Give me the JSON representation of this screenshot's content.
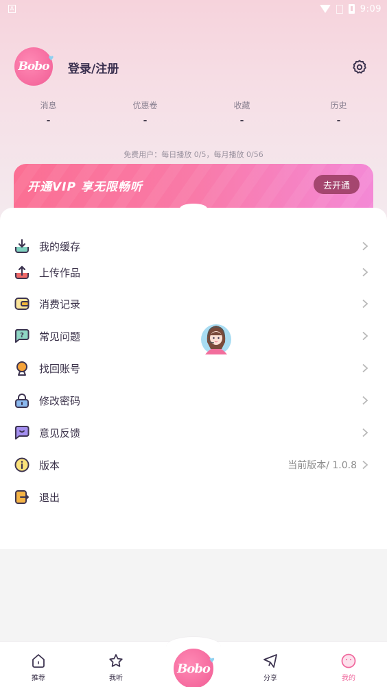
{
  "status_bar": {
    "app_indicator": "A",
    "time": "9:09"
  },
  "profile": {
    "logo_text": "Bobo",
    "login_label": "登录/注册",
    "settings_icon": "gear-icon"
  },
  "stats": [
    {
      "label": "消息",
      "value": "-"
    },
    {
      "label": "优惠卷",
      "value": "-"
    },
    {
      "label": "收藏",
      "value": "-"
    },
    {
      "label": "历史",
      "value": "-"
    }
  ],
  "quota_text": "免费用户：每日播放 0/5，每月播放 0/56",
  "vip": {
    "title": "开通VIP 享无限畅听",
    "button_label": "去开通"
  },
  "menu": [
    {
      "label": "我的缓存",
      "icon": "download-icon",
      "extra": ""
    },
    {
      "label": "上传作品",
      "icon": "upload-icon",
      "extra": ""
    },
    {
      "label": "消费记录",
      "icon": "wallet-icon",
      "extra": ""
    },
    {
      "label": "常见问题",
      "icon": "question-bubble-icon",
      "extra": ""
    },
    {
      "label": "找回账号",
      "icon": "account-recover-icon",
      "extra": ""
    },
    {
      "label": "修改密码",
      "icon": "lock-icon",
      "extra": ""
    },
    {
      "label": "意见反馈",
      "icon": "feedback-icon",
      "extra": ""
    },
    {
      "label": "版本",
      "icon": "info-icon",
      "extra": "当前版本/ 1.0.8"
    },
    {
      "label": "退出",
      "icon": "logout-icon",
      "extra": ""
    }
  ],
  "bottom_nav": [
    {
      "label": "推荐",
      "icon": "home-icon",
      "active": false
    },
    {
      "label": "我听",
      "icon": "star-icon",
      "active": false
    },
    {
      "label": "",
      "icon": "bobo-logo-icon",
      "active": false
    },
    {
      "label": "分享",
      "icon": "paper-plane-icon",
      "active": false
    },
    {
      "label": "我的",
      "icon": "face-icon",
      "active": true
    }
  ],
  "colors": {
    "accent": "#f06b9f",
    "vip_button": "#a5466f",
    "text_primary": "#3a3149"
  }
}
